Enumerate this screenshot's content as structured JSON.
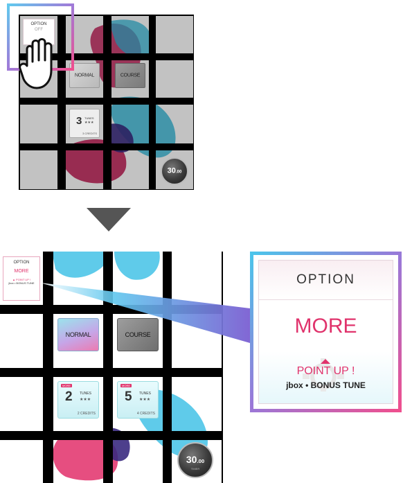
{
  "top_panel": {
    "option_title": "OPTION",
    "option_value": "OFF",
    "normal_label": "NORMAL",
    "course_label": "COURSE",
    "tune_number": "3",
    "tune_unit": "TUNES",
    "tune_stars": "★★★",
    "tune_credits": "3 CREDITS",
    "timer_value": "30",
    "timer_decimals": ".00"
  },
  "bottom_panel": {
    "option_title": "OPTION",
    "option_value": "MORE",
    "option_point": "▲ POINT UP !",
    "option_sub": "jbox • BONUS TUNE",
    "normal_label": "NORMAL",
    "course_label": "COURSE",
    "card_tag": "MORE",
    "tune_a_number": "2",
    "tune_a_unit": "TUNES",
    "tune_a_stars": "★★★",
    "tune_a_credits": "2 CREDITS",
    "tune_b_number": "5",
    "tune_b_unit": "TUNES",
    "tune_b_stars": "★★★",
    "tune_b_credits": "4 CREDITS",
    "timer_value": "30",
    "timer_decimals": ".00",
    "timer_sub": "TIMER"
  },
  "zoom": {
    "title": "OPTION",
    "value": "MORE",
    "point_up": "POINT UP !",
    "subtitle": "jbox • BONUS TUNE"
  },
  "icons": [
    "hand-pointer-icon",
    "arrow-down-icon",
    "gear-icon",
    "caret-up-icon"
  ],
  "colors": {
    "accent_pink": "#e0336c",
    "accent_cyan": "#3cc3e6",
    "accent_purple": "#6a3aa0",
    "grid_black": "#000000",
    "cell_gray": "#c2c2c2"
  }
}
